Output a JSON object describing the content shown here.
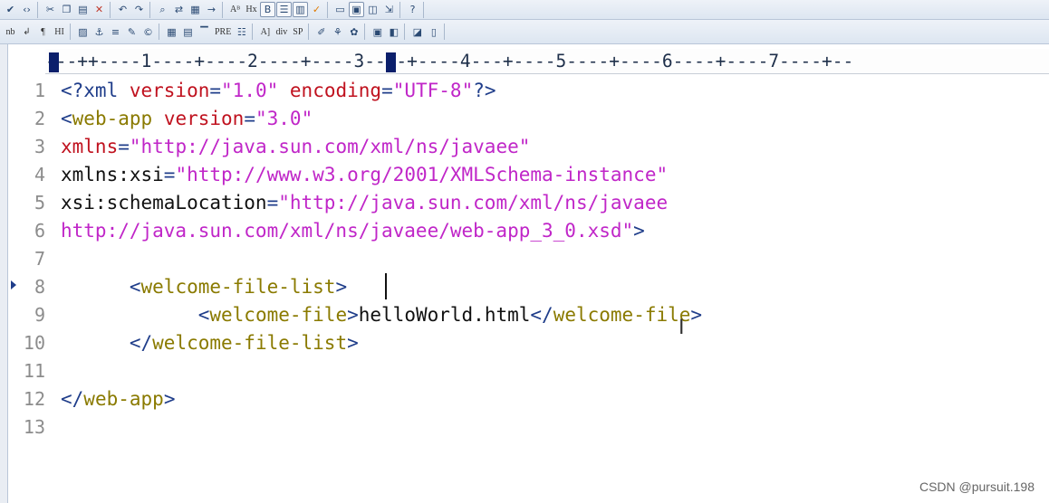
{
  "toolbar_row1": {
    "icons": [
      "spellcheck-icon",
      "code-icon",
      "cut-icon",
      "copy-icon",
      "paste-icon",
      "delete-icon",
      "undo-icon",
      "redo-icon",
      "find-icon",
      "replace-icon",
      "find-in-files-icon",
      "goto-icon",
      "font-size-icon",
      "heading-icon",
      "paragraph-icon",
      "list-icon",
      "abc-icon",
      "validate-check-icon",
      "window-icon",
      "tile-icon",
      "cascade-icon",
      "help-context-icon"
    ],
    "font_label": "Aᴮ",
    "hx_label": "Hx"
  },
  "toolbar_row2": {
    "nb_label": "nb",
    "br_label": "↲",
    "para_label": "¶",
    "hi_label": "HI",
    "div_label": "div",
    "sp_label": "SP",
    "a_label": "A]",
    "pre_label": "PRE"
  },
  "ruler": {
    "text": "---++----1----+----2----+----3----+----4---+----5----+----6----+----7----+--"
  },
  "editor": {
    "lines": [
      {
        "num": "1",
        "parts": [
          [
            "pi",
            "<?xml "
          ],
          [
            "attr",
            "version"
          ],
          [
            "pi",
            "="
          ],
          [
            "val",
            "\"1.0\""
          ],
          [
            "pi",
            " "
          ],
          [
            "attr",
            "encoding"
          ],
          [
            "pi",
            "="
          ],
          [
            "val",
            "\"UTF-8\""
          ],
          [
            "pi",
            "?>"
          ]
        ]
      },
      {
        "num": "2",
        "parts": [
          [
            "brk",
            "<"
          ],
          [
            "tag",
            "web-app"
          ],
          [
            "text",
            " "
          ],
          [
            "attr",
            "version"
          ],
          [
            "brk",
            "="
          ],
          [
            "val",
            "\"3.0\""
          ]
        ]
      },
      {
        "num": "3",
        "parts": [
          [
            "attr",
            "xmlns"
          ],
          [
            "brk",
            "="
          ],
          [
            "val",
            "\"http://java.sun.com/xml/ns/javaee\""
          ]
        ]
      },
      {
        "num": "4",
        "parts": [
          [
            "text",
            "xmlns:xsi"
          ],
          [
            "brk",
            "="
          ],
          [
            "val",
            "\"http://www.w3.org/2001/XMLSchema-instance\""
          ]
        ]
      },
      {
        "num": "5",
        "parts": [
          [
            "text",
            "xsi:schemaLocation"
          ],
          [
            "brk",
            "="
          ],
          [
            "val",
            "\"http://java.sun.com/xml/ns/javaee"
          ]
        ]
      },
      {
        "num": "6",
        "parts": [
          [
            "val",
            "http://java.sun.com/xml/ns/javaee/web-app_3_0.xsd\""
          ],
          [
            "brk",
            ">"
          ]
        ]
      },
      {
        "num": "7",
        "parts": []
      },
      {
        "num": "8",
        "parts": [
          [
            "text",
            "      "
          ],
          [
            "brk",
            "<"
          ],
          [
            "tag",
            "welcome-file-list"
          ],
          [
            "brk",
            ">"
          ]
        ]
      },
      {
        "num": "9",
        "parts": [
          [
            "text",
            "            "
          ],
          [
            "brk",
            "<"
          ],
          [
            "tag",
            "welcome-file"
          ],
          [
            "brk",
            ">"
          ],
          [
            "text",
            "helloWorld.html"
          ],
          [
            "brk",
            "</"
          ],
          [
            "tag",
            "welcome-file"
          ],
          [
            "brk",
            ">"
          ]
        ]
      },
      {
        "num": "10",
        "parts": [
          [
            "text",
            "      "
          ],
          [
            "brk",
            "</"
          ],
          [
            "tag",
            "welcome-file-list"
          ],
          [
            "brk",
            ">"
          ]
        ]
      },
      {
        "num": "11",
        "parts": []
      },
      {
        "num": "12",
        "parts": [
          [
            "brk",
            "</"
          ],
          [
            "tag",
            "web-app"
          ],
          [
            "brk",
            ">"
          ]
        ]
      },
      {
        "num": "13",
        "parts": []
      }
    ]
  },
  "watermark": "CSDN @pursuit.198"
}
